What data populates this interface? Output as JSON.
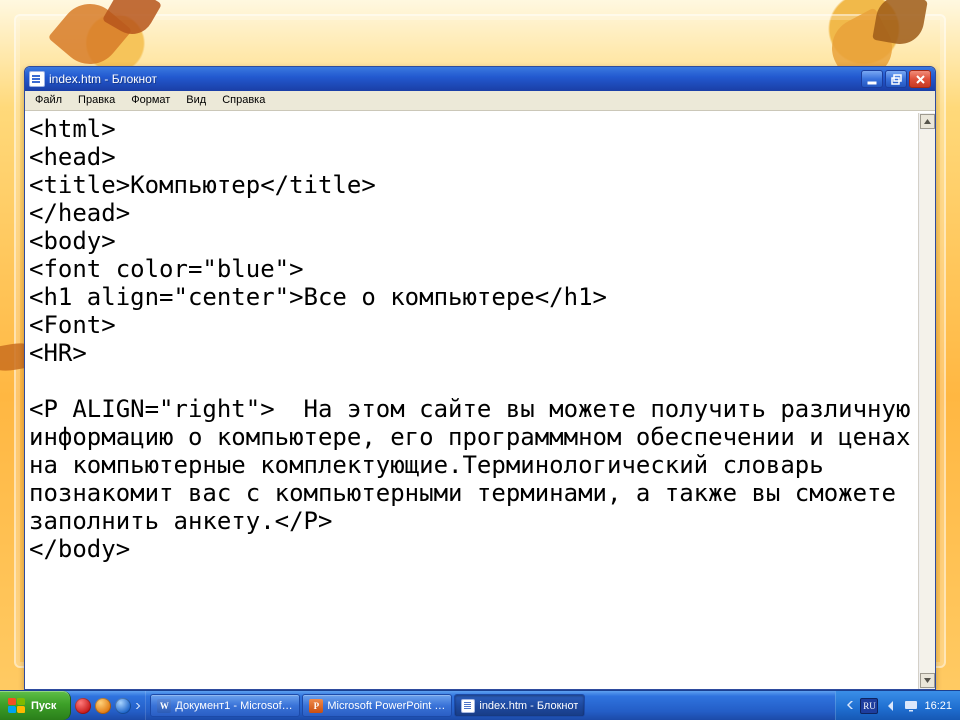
{
  "window": {
    "title": "index.htm - Блокнот",
    "menu": {
      "file": "Файл",
      "edit": "Правка",
      "format": "Формат",
      "view": "Вид",
      "help": "Справка"
    }
  },
  "editor": {
    "content": "<html>\n<head>\n<title>Компьютер</title>\n</head>\n<body>\n<font color=\"blue\">\n<h1 align=\"center\">Все о компьютере</h1>\n<Font>\n<HR>\n\n<P ALIGN=\"right\">  На этом сайте вы можете получить различную информацию о компьютере, его программмном обеспечении и ценах на компьютерные комплектующие.Терминологический словарь познакомит вас с компьютерными терминами, а также вы сможете заполнить анкету.</P>\n</body>"
  },
  "taskbar": {
    "start_label": "Пуск",
    "items": [
      {
        "label": "Документ1 - Microsoft ...",
        "icon": "word",
        "active": false
      },
      {
        "label": "Microsoft PowerPoint - [...",
        "icon": "ppt",
        "active": false
      },
      {
        "label": "index.htm - Блокнот",
        "icon": "np",
        "active": true
      }
    ],
    "lang": "RU",
    "clock": "16:21"
  }
}
